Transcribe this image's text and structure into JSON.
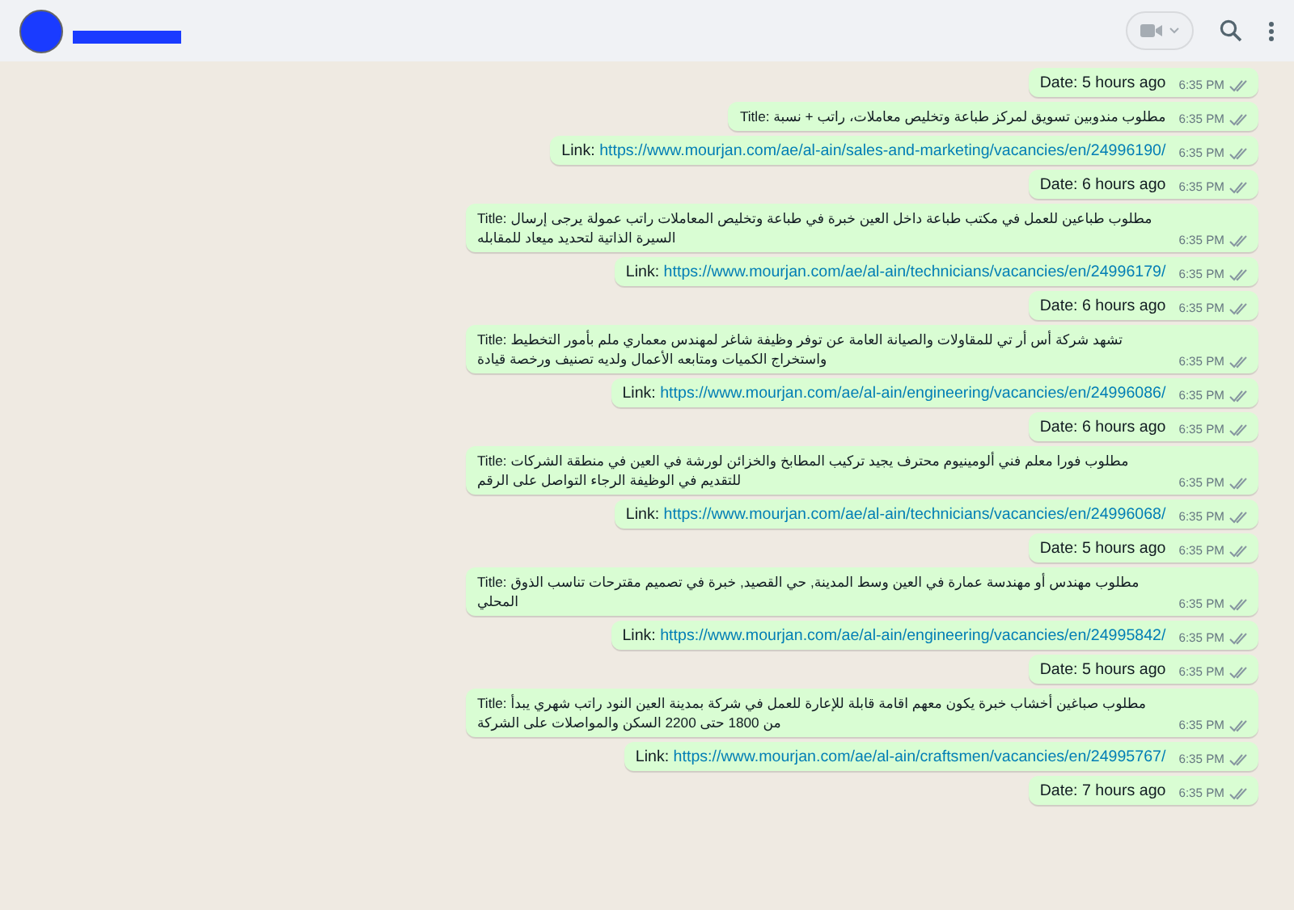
{
  "messages": [
    {
      "kind": "date",
      "text": "Date: 5 hours ago",
      "time": "6:35 PM"
    },
    {
      "kind": "title",
      "text": "Title: مطلوب مندوبين تسويق لمركز طباعة وتخليص معاملات، راتب + نسبة",
      "time": "6:35 PM"
    },
    {
      "kind": "link",
      "label": "Link:",
      "url": "https://www.mourjan.com/ae/al-ain/sales-and-marketing/vacancies/en/24996190/",
      "time": "6:35 PM"
    },
    {
      "kind": "date",
      "text": "Date: 6 hours ago",
      "time": "6:35 PM"
    },
    {
      "kind": "title",
      "text": "Title: مطلوب طباعين للعمل في مكتب طباعة داخل العين خبرة في طباعة وتخليص المعاملات راتب عمولة يرجى إرسال السيرة الذاتية لتحديد ميعاد للمقابله",
      "time": "6:35 PM"
    },
    {
      "kind": "link",
      "label": "Link:",
      "url": "https://www.mourjan.com/ae/al-ain/technicians/vacancies/en/24996179/",
      "time": "6:35 PM"
    },
    {
      "kind": "date",
      "text": "Date: 6 hours ago",
      "time": "6:35 PM"
    },
    {
      "kind": "title",
      "text": "Title: تشهد شركة أس أر تي للمقاولات والصيانة العامة عن توفر وظيفة شاغر لمهندس معماري ملم بأمور التخطيط واستخراج الكميات ومتابعه الأعمال ولديه تصنيف ورخصة قيادة",
      "time": "6:35 PM"
    },
    {
      "kind": "link",
      "label": "Link:",
      "url": "https://www.mourjan.com/ae/al-ain/engineering/vacancies/en/24996086/",
      "time": "6:35 PM"
    },
    {
      "kind": "date",
      "text": "Date: 6 hours ago",
      "time": "6:35 PM"
    },
    {
      "kind": "title",
      "text": "Title: مطلوب فورا معلم فني ألومينيوم محترف يجيد تركيب المطابخ والخزائن لورشة في العين في منطقة الشركات للتقديم في الوظيفة الرجاء التواصل على الرقم",
      "time": "6:35 PM"
    },
    {
      "kind": "link",
      "label": "Link:",
      "url": "https://www.mourjan.com/ae/al-ain/technicians/vacancies/en/24996068/",
      "time": "6:35 PM"
    },
    {
      "kind": "date",
      "text": "Date: 5 hours ago",
      "time": "6:35 PM"
    },
    {
      "kind": "title",
      "text": "Title: مطلوب مهندس أو مهندسة عمارة في العين وسط المدينة, حي القصيد, خبرة في تصميم مقترحات تناسب الذوق المحلي",
      "time": "6:35 PM"
    },
    {
      "kind": "link",
      "label": "Link:",
      "url": "https://www.mourjan.com/ae/al-ain/engineering/vacancies/en/24995842/",
      "time": "6:35 PM"
    },
    {
      "kind": "date",
      "text": "Date: 5 hours ago",
      "time": "6:35 PM"
    },
    {
      "kind": "title",
      "text": "Title: مطلوب صباغين أخشاب خبرة يكون معهم اقامة قابلة للإعارة للعمل في شركة بمدينة العين النود راتب شهري يبدأ من 1800 حتى 2200 السكن والمواصلات على الشركة",
      "time": "6:35 PM"
    },
    {
      "kind": "link",
      "label": "Link:",
      "url": "https://www.mourjan.com/ae/al-ain/craftsmen/vacancies/en/24995767/",
      "time": "6:35 PM"
    },
    {
      "kind": "date",
      "text": "Date: 7 hours ago",
      "time": "6:35 PM"
    }
  ]
}
